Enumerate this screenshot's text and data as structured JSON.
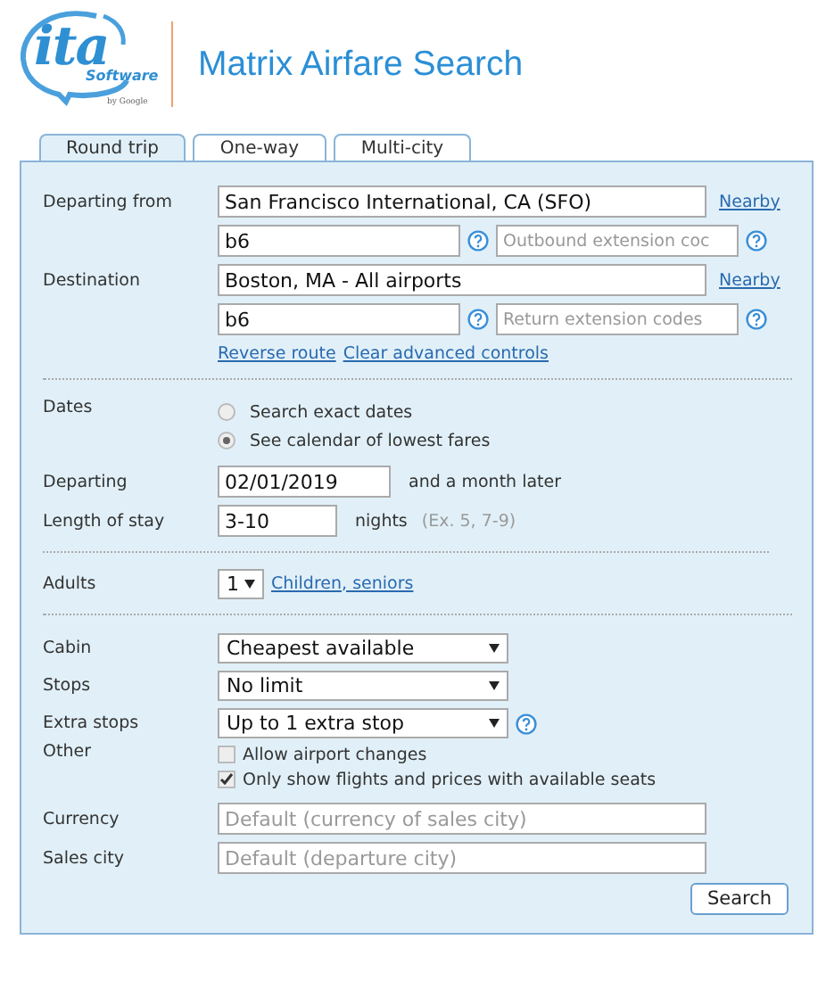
{
  "header": {
    "logo": {
      "mark": "ita",
      "sub": "Software",
      "byline": "by Google"
    },
    "title": "Matrix Airfare Search"
  },
  "tabs": [
    {
      "label": "Round trip",
      "selected": true
    },
    {
      "label": "One-way",
      "selected": false
    },
    {
      "label": "Multi-city",
      "selected": false
    }
  ],
  "route": {
    "legs": [
      {
        "label": "Departing from",
        "value": "San Francisco International, CA (SFO)",
        "nearby": "Nearby",
        "routing": "b6",
        "extension_placeholder": "Outbound extension coc"
      },
      {
        "label": "Destination",
        "value": "Boston, MA - All airports",
        "nearby": "Nearby",
        "routing": "b6",
        "extension_placeholder": "Return extension codes"
      }
    ],
    "links": [
      "Reverse route",
      "Clear advanced controls"
    ]
  },
  "dates": {
    "label": "Dates",
    "options": [
      {
        "label": "Search exact dates",
        "selected": false
      },
      {
        "label": "See calendar of lowest fares",
        "selected": true
      }
    ],
    "departing": {
      "label": "Departing",
      "value": "02/01/2019",
      "note": "and a month later"
    },
    "stay": {
      "label": "Length of stay",
      "value": "3-10",
      "unit": "nights",
      "hint": "(Ex. 5, 7-9)"
    }
  },
  "passengers": {
    "label": "Adults",
    "value": "1",
    "link": "Children, seniors"
  },
  "options": {
    "selects": [
      {
        "label": "Cabin",
        "value": "Cheapest available",
        "help": false
      },
      {
        "label": "Stops",
        "value": "No limit",
        "help": false
      },
      {
        "label": "Extra stops",
        "value": "Up to 1 extra stop",
        "help": true
      }
    ],
    "other": {
      "label": "Other",
      "checks": [
        {
          "label": "Allow airport changes",
          "checked": false
        },
        {
          "label": "Only show flights and prices with available seats",
          "checked": true
        }
      ]
    },
    "fields": [
      {
        "label": "Currency",
        "placeholder": "Default (currency of sales city)"
      },
      {
        "label": "Sales city",
        "placeholder": "Default (departure city)"
      }
    ]
  },
  "search_button": "Search"
}
